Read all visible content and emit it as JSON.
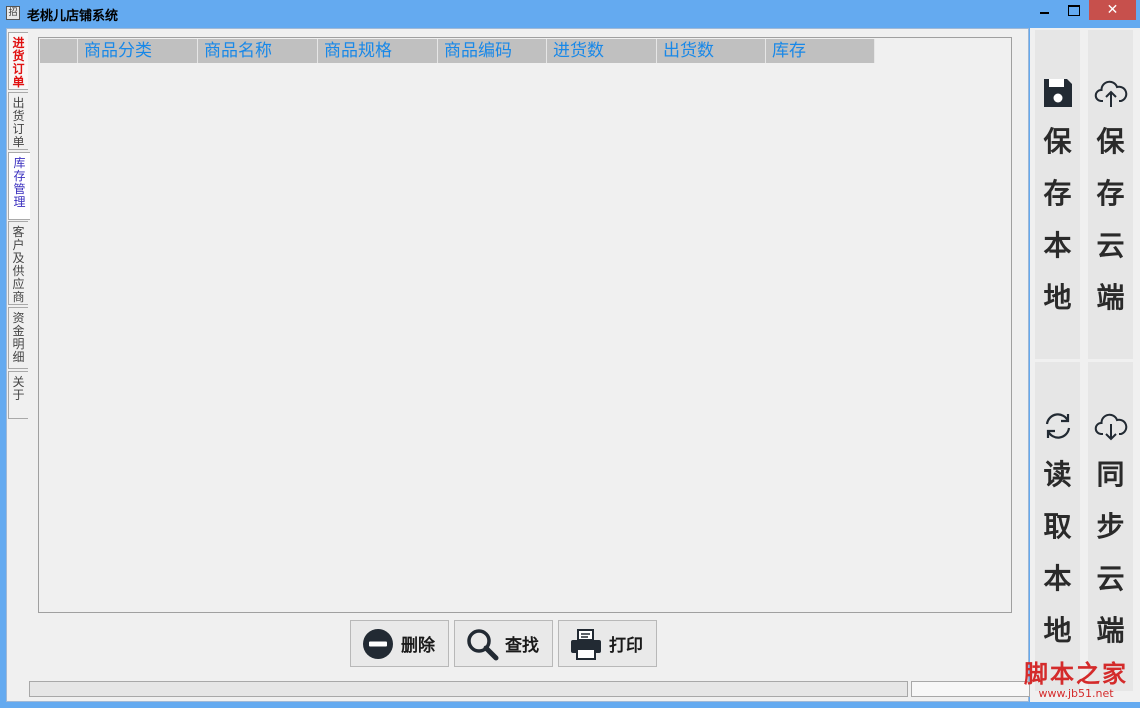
{
  "window": {
    "title": "老桃儿店铺系统",
    "icon_text": "招",
    "close_glyph": "✕"
  },
  "tabs": [
    {
      "label": "进货订单",
      "state": "active-red"
    },
    {
      "label": "出货订单",
      "state": "normal"
    },
    {
      "label": "库存管理",
      "state": "selected"
    },
    {
      "label": "客户及供应商",
      "state": "normal"
    },
    {
      "label": "资金明细",
      "state": "normal"
    },
    {
      "label": "关于",
      "state": "normal"
    }
  ],
  "grid": {
    "columns": [
      "商品分类",
      "商品名称",
      "商品规格",
      "商品编码",
      "进货数",
      "出货数",
      "库存"
    ],
    "rows": []
  },
  "actions": {
    "delete_label": "删除",
    "find_label": "查找",
    "print_label": "打印"
  },
  "toolbar": {
    "save_local_label": "保存本地",
    "save_cloud_label": "保存云端",
    "load_local_label": "读取本地",
    "sync_cloud_label": "同步云端"
  },
  "watermark": {
    "text": "脚本之家",
    "url": "www.jb51.net"
  },
  "colors": {
    "frame": "#64aaf0",
    "header_text": "#1888e8",
    "header_bg": "#c0c0c0",
    "close_button": "#c7504c",
    "active_tab_text": "#e01010",
    "selected_tab_text": "#3a2fbf",
    "watermark": "#d42b2b"
  }
}
